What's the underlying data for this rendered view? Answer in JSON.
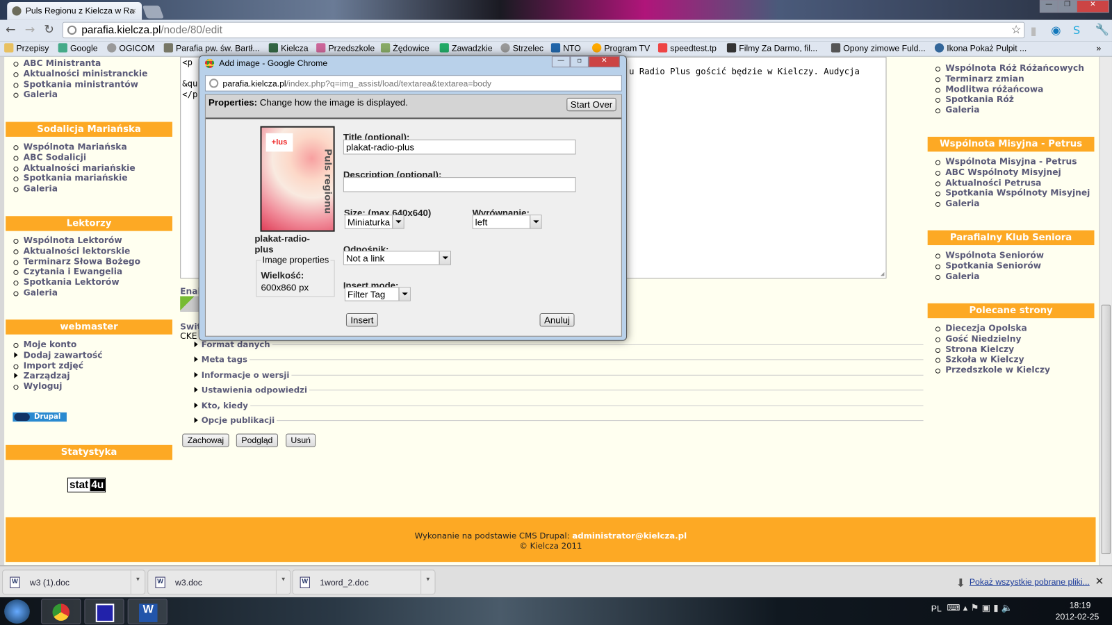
{
  "browser": {
    "tab_title": "Puls Regionu z Kielcza w Ra",
    "url_host": "parafia.kielcza.pl",
    "url_path": "/node/80/edit",
    "bookmarks": [
      "Przepisy",
      "Google",
      "OGICOM",
      "Parafia pw. św. Bartł...",
      "Kielcza",
      "Przedszkole",
      "Żędowice",
      "Zawadzkie",
      "Strzelec",
      "NTO",
      "Program TV",
      "speedtest.tp",
      "Filmy Za Darmo, fil...",
      "Opony zimowe Fuld...",
      "Ikona Pokaż Pulpit ..."
    ]
  },
  "left_sidebar": {
    "top_items": [
      "ABC Ministranta",
      "Aktualności ministranckie",
      "Spotkania ministrantów",
      "Galeria"
    ],
    "sections": [
      {
        "title": "Sodalicja Mariańska",
        "items": [
          "Wspólnota Mariańska",
          "ABC Sodalicji",
          "Aktualności mariańskie",
          "Spotkania mariańskie",
          "Galeria"
        ]
      },
      {
        "title": "Lektorzy",
        "items": [
          "Wspólnota Lektorów",
          "Aktualności lektorskie",
          "Terminarz Słowa Bożego",
          "Czytania i Ewangelia",
          "Spotkania Lektorów",
          "Galeria"
        ]
      },
      {
        "title": "webmaster",
        "items": [
          "Moje konto",
          "Dodaj zawartość",
          "Import zdjęć",
          "Zarządzaj",
          "Wyloguj"
        ]
      },
      {
        "title": "Statystyka",
        "items": []
      }
    ],
    "drupal_badge": "Drupal",
    "stat_badge_a": "stat",
    "stat_badge_b": "4u"
  },
  "right_sidebar": {
    "top_items": [
      "Wspólnota Róż Różańcowych",
      "Terminarz zmian",
      "Modlitwa różańcowa",
      "Spotkania Róż",
      "Galeria"
    ],
    "sections": [
      {
        "title": "Wspólnota Misyjna - Petrus",
        "items": [
          "Wspólnota Misyjna - Petrus",
          "ABC Wspólnoty Misyjnej",
          "Aktualności Petrusa",
          "Spotkania Wspólnoty Misyjnej",
          "Galeria"
        ]
      },
      {
        "title": "Parafialny Klub Seniora",
        "items": [
          "Wspólnota Seniorów",
          "Spotkania Seniorów",
          "Galeria"
        ]
      },
      {
        "title": "Polecane strony",
        "items": [
          "Diecezja Opolska",
          "Gość Niedzielny",
          "Strona Kielczy",
          "Szkoła w Kielczy",
          "Przedszkole w Kielczy"
        ]
      }
    ]
  },
  "editor": {
    "line1_start": "<p",
    "line1_end": "u Radio Plus gościć będzie w Kielczy. Audycja",
    "line2": "&qu",
    "line3": "</p",
    "enable_text": "Enal",
    "switch_text": "Swit",
    "ckeditor_text": "CKE"
  },
  "fieldsets": [
    "Format danych",
    "Meta tags",
    "Informacje o wersji",
    "Ustawienia odpowiedzi",
    "Kto, kiedy",
    "Opcje publikacji"
  ],
  "form_buttons": {
    "save": "Zachowaj",
    "preview": "Podgląd",
    "delete": "Usuń"
  },
  "footer": {
    "text": "Wykonanie na podstawie CMS Drupal:",
    "email": "administrator@kielcza.pl",
    "copyright": "© Kielcza 2011"
  },
  "dialog": {
    "title": "Add image - Google Chrome",
    "url_host": "parafia.kielcza.pl",
    "url_path": "/index.php?q=img_assist/load/textarea&textarea=body",
    "properties_label": "Properties:",
    "properties_text": "Change how the image is displayed.",
    "start_over": "Start Over",
    "image_name": "plakat-radio-plus",
    "image_properties_legend": "Image properties",
    "size_label": "Wielkość:",
    "size_value": "600x860 px",
    "title_label": "Title (optional):",
    "title_value": "plakat-radio-plus",
    "description_label": "Description (optional):",
    "description_value": "",
    "size_select_label": "Size: (max 640x640)",
    "size_select_value": "Miniaturka",
    "align_label": "Wyrównanie:",
    "align_value": "left",
    "link_label": "Odnośnik:",
    "link_value": "Not a link",
    "insert_mode_label": "Insert mode:",
    "insert_mode_value": "Filter Tag",
    "insert_button": "Insert",
    "cancel_button": "Anuluj",
    "poster_text": "Puls regionu"
  },
  "downloads": {
    "items": [
      "w3 (1).doc",
      "w3.doc",
      "1word_2.doc"
    ],
    "show_all": "Pokaż wszystkie pobrane pliki..."
  },
  "taskbar": {
    "lang": "PL",
    "time": "18:19",
    "date": "2012-02-25"
  },
  "colors": {
    "accent": "#fda924",
    "page_bg": "#fffff0",
    "link": "#5a5a78"
  }
}
